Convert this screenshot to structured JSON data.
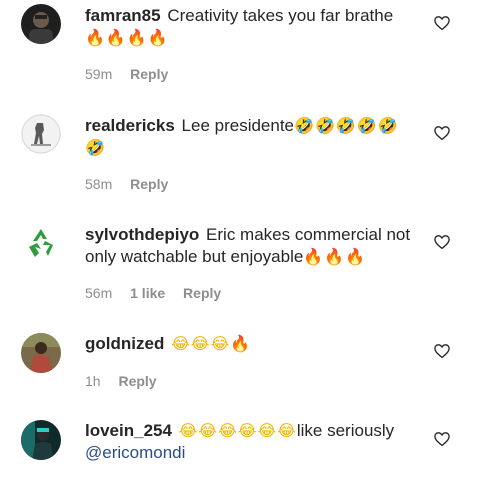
{
  "comments": [
    {
      "username": "famran85",
      "text": "Creativity takes you far brathe",
      "emojis": "🔥🔥🔥🔥",
      "time": "59m",
      "likes": "",
      "reply_label": "Reply"
    },
    {
      "username": "realdericks",
      "text": "Lee presidente",
      "emojis": "🤣🤣🤣🤣🤣",
      "emojis_line2": "🤣",
      "time": "58m",
      "likes": "",
      "reply_label": "Reply"
    },
    {
      "username": "sylvothdepiyo",
      "text": "Eric makes commercial not only watchable but enjoyable",
      "emojis": "🔥🔥🔥",
      "time": "56m",
      "likes": "1 like",
      "reply_label": "Reply"
    },
    {
      "username": "goldnized",
      "text": "",
      "emojis": "😂😂😂🔥",
      "time": "1h",
      "likes": "",
      "reply_label": "Reply"
    },
    {
      "username": "lovein_254",
      "text": "like seriously",
      "emojis": "😂😂😂😂😂😂",
      "mention": "@ericomondi",
      "time": "",
      "likes": "",
      "reply_label": ""
    }
  ],
  "icons": {
    "like": "heart-outline-icon"
  },
  "colors": {
    "text": "#262626",
    "meta": "#8e8e8e",
    "mention": "#2a4d86"
  }
}
